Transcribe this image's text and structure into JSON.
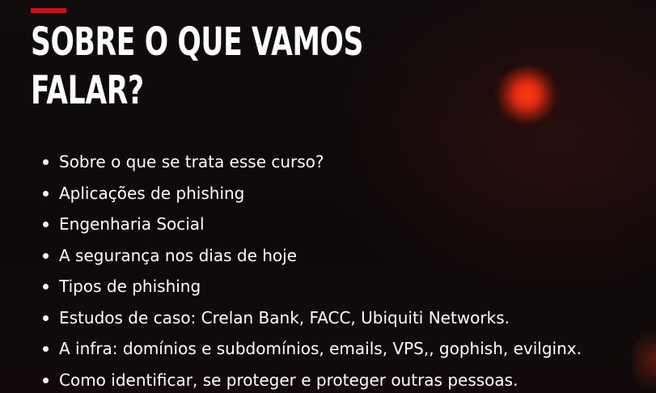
{
  "slide": {
    "title_lines": [
      "SOBRE O QUE VAMOS",
      "FALAR?"
    ],
    "accent_color": "#c8121a",
    "glow_color": "#ff3a12",
    "topics": [
      "Sobre o que se trata esse curso?",
      "Aplicações de phishing",
      "Engenharia Social",
      "A segurança nos dias de hoje",
      "Tipos de phishing",
      "Estudos de caso: Crelan Bank, FACC, Ubiquiti Networks.",
      "A infra: domínios e subdomínios, emails, VPS,, gophish, evilginx.",
      "Como identificar, se proteger e proteger outras pessoas."
    ]
  }
}
